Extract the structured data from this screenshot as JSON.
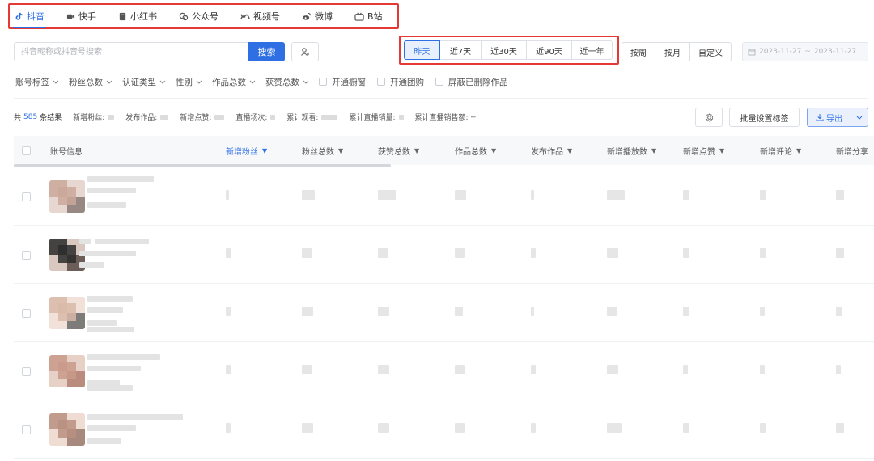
{
  "platform_tabs": [
    {
      "label": "抖音",
      "icon": "douyin-icon",
      "active": true
    },
    {
      "label": "快手",
      "icon": "kuaishou-icon",
      "active": false
    },
    {
      "label": "小红书",
      "icon": "xiaohongshu-icon",
      "active": false
    },
    {
      "label": "公众号",
      "icon": "wechat-official-icon",
      "active": false
    },
    {
      "label": "视频号",
      "icon": "video-account-icon",
      "active": false
    },
    {
      "label": "微博",
      "icon": "weibo-icon",
      "active": false
    },
    {
      "label": "B站",
      "icon": "bilibili-icon",
      "active": false
    }
  ],
  "search": {
    "placeholder": "抖音昵称或抖音号搜索",
    "button_label": "搜索",
    "filter_icon": "user-filter-icon"
  },
  "time_ranges": [
    {
      "label": "昨天",
      "active": true
    },
    {
      "label": "近7天",
      "active": false
    },
    {
      "label": "近30天",
      "active": false
    },
    {
      "label": "近90天",
      "active": false
    },
    {
      "label": "近一年",
      "active": false
    }
  ],
  "periods": [
    "按周",
    "按月",
    "自定义"
  ],
  "date_range": {
    "start": "2023-11-27",
    "separator": "~",
    "end": "2023-11-27",
    "icon": "calendar-icon"
  },
  "filters": {
    "dropdowns": [
      "账号标签",
      "粉丝总数",
      "认证类型",
      "性别",
      "作品总数",
      "获赞总数"
    ],
    "checkboxes": [
      "开通橱窗",
      "开通团购",
      "屏蔽已删除作品"
    ]
  },
  "summary": {
    "prefix": "共",
    "count": "585",
    "suffix": "条结果",
    "stats": [
      {
        "label": "新增粉丝:"
      },
      {
        "label": "发布作品:"
      },
      {
        "label": "新增点赞:"
      },
      {
        "label": "直播场次:"
      },
      {
        "label": "累计观看:"
      },
      {
        "label": "累计直播销量:"
      },
      {
        "label": "累计直播销售额:",
        "value": "--"
      }
    ]
  },
  "actions": {
    "settings_icon": "settings-icon",
    "batch_label": "批量设置标签",
    "export_label": "导出",
    "export_icon": "download-icon"
  },
  "table": {
    "columns": [
      {
        "label": "账号信息",
        "sortable": false
      },
      {
        "label": "新增粉丝",
        "sortable": true,
        "sorted": true
      },
      {
        "label": "粉丝总数",
        "sortable": true
      },
      {
        "label": "获赞总数",
        "sortable": true
      },
      {
        "label": "作品总数",
        "sortable": true
      },
      {
        "label": "发布作品",
        "sortable": true
      },
      {
        "label": "新增播放数",
        "sortable": true
      },
      {
        "label": "新增点赞",
        "sortable": true
      },
      {
        "label": "新增评论",
        "sortable": true
      },
      {
        "label": "新增分享",
        "sortable": true
      }
    ],
    "rows_count": 5
  },
  "colors": {
    "accent": "#2f6fe4",
    "highlight_border": "#e53935"
  }
}
